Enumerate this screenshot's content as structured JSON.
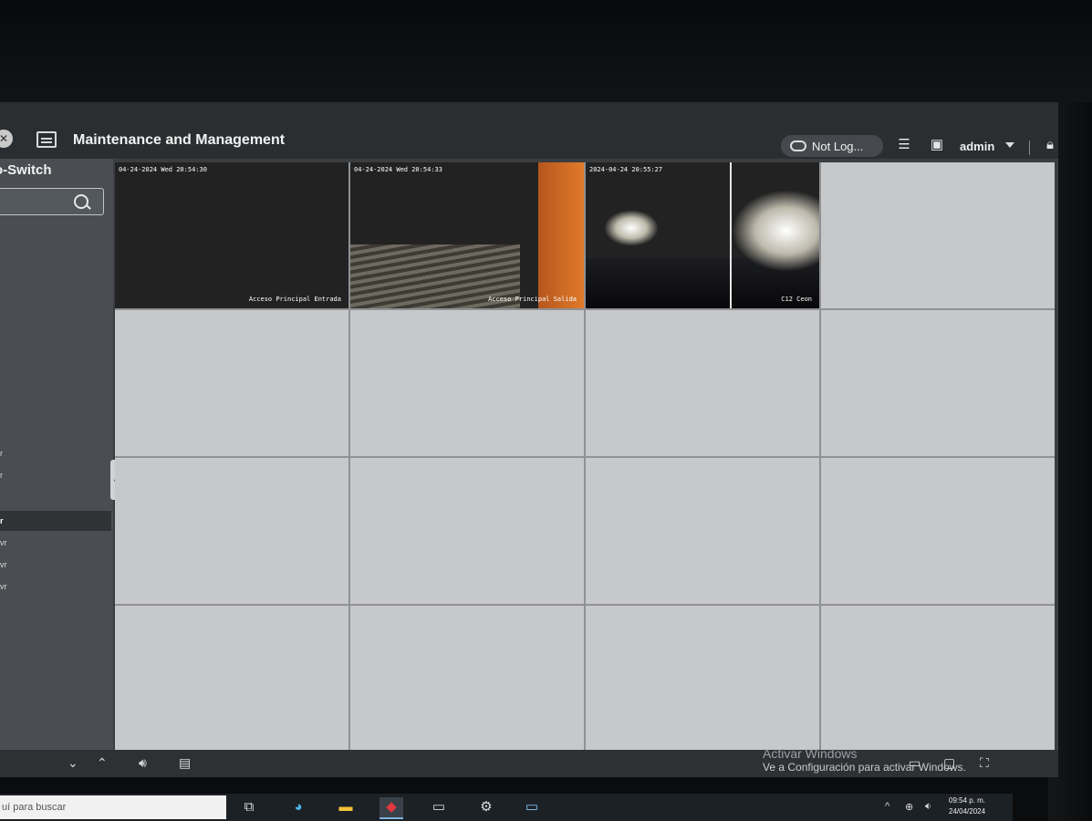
{
  "window": {
    "title": "Maintenance and Management",
    "cloud_status": "Not Log...",
    "user": "admin"
  },
  "sidebar": {
    "title": "o-Switch",
    "search_placeholder": "",
    "items": [
      "r",
      "r",
      "r",
      "vr",
      "vr",
      "vr"
    ]
  },
  "cameras": [
    {
      "time": "04-24-2024 Wed 20:54:30",
      "name": "Acceso Principal Entrada"
    },
    {
      "time": "04-24-2024 Wed 20:54:33",
      "name": "Acceso Principal Salida"
    },
    {
      "time": "2024-04-24 20:55:27",
      "name": "C12 Ceon"
    }
  ],
  "watermark": {
    "line1": "Activar Windows",
    "line2": "Ve a Configuración para activar Windows."
  },
  "taskbar": {
    "search_text": "uí para buscar",
    "time": "09:54 p. m.",
    "date": "24/04/2024"
  },
  "icons": {
    "list": "list-icon",
    "image": "image-icon",
    "lock": "lock-icon",
    "minimize": "minimize-icon",
    "volume": "volume-icon",
    "save": "save-icon"
  }
}
